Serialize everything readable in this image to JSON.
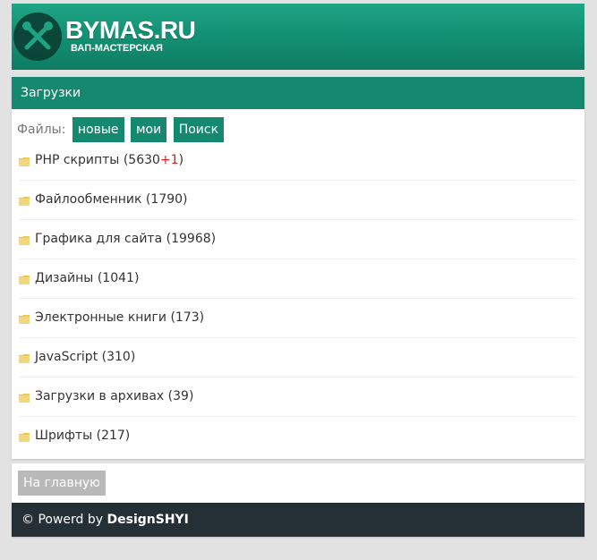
{
  "header": {
    "title": "BYMAS.RU",
    "subtitle": "ВАП-МАСТЕРСКАЯ",
    "logo_icon": "tools-icon"
  },
  "section": {
    "title": "Загрузки",
    "files_label": "Файлы:",
    "chips": [
      "новые",
      "мои",
      "Поиск"
    ]
  },
  "categories": [
    {
      "name": "PHP скрипты",
      "count": "5630",
      "extra": "+1"
    },
    {
      "name": "Файлообменник",
      "count": "1790"
    },
    {
      "name": "Графика для сайта",
      "count": "19968"
    },
    {
      "name": "Дизайны",
      "count": "1041"
    },
    {
      "name": "Электронные книги",
      "count": "173"
    },
    {
      "name": "JavaScript",
      "count": "310"
    },
    {
      "name": "Загрузки в архивах",
      "count": "39"
    },
    {
      "name": "Шрифты",
      "count": "217"
    }
  ],
  "home_button": "На главную",
  "footer": {
    "prefix": "© Powerd by ",
    "brand": "DesignSHYI"
  },
  "colors": {
    "accent": "#15896f",
    "footer_bg": "#243036",
    "extra_red": "#e0201b"
  }
}
